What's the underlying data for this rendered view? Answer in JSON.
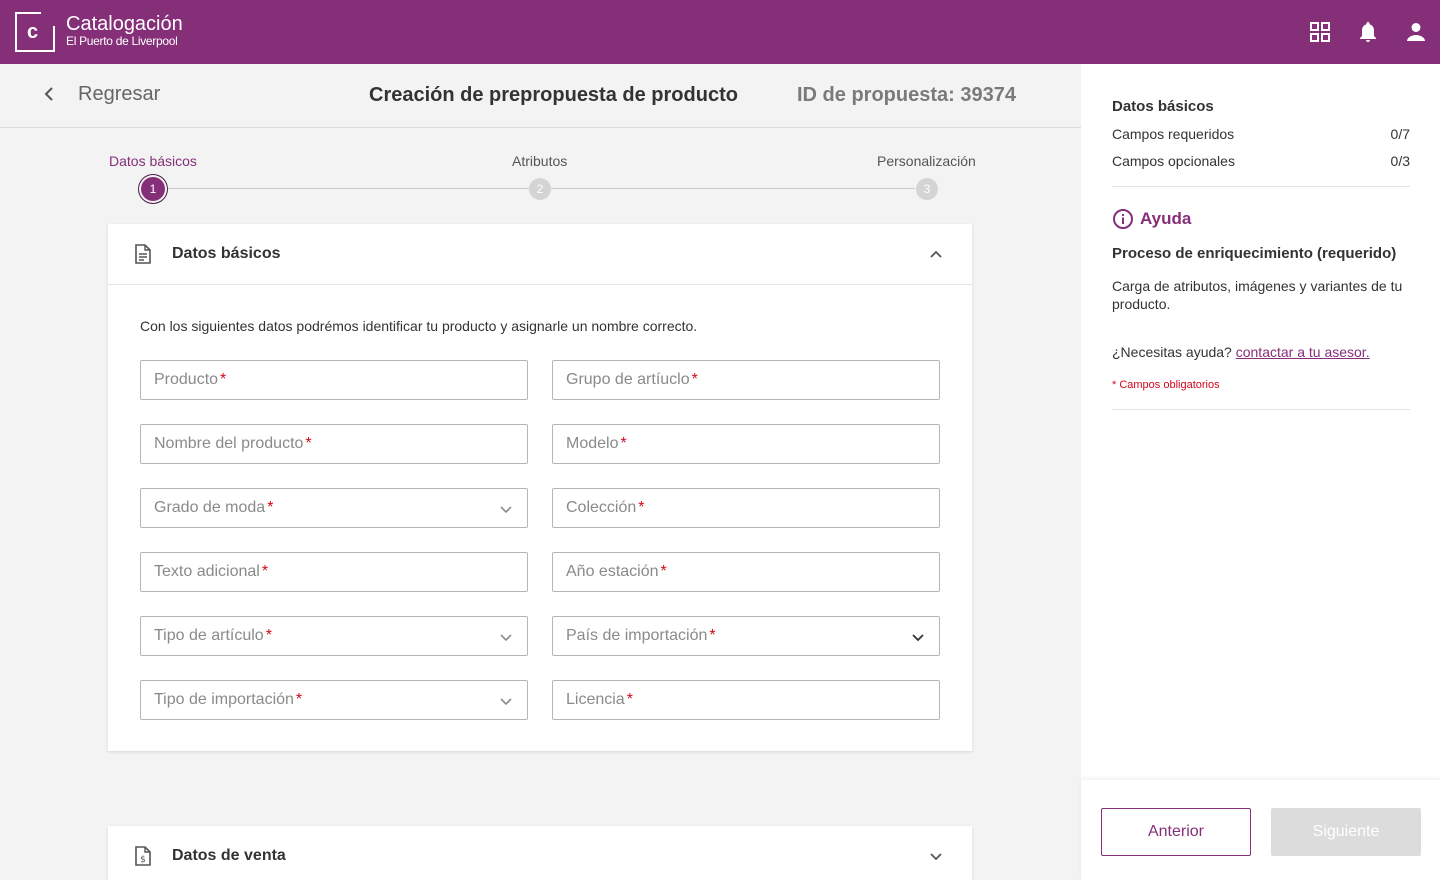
{
  "brand": {
    "name": "Catalogación",
    "sub": "El Puerto de Liverpool",
    "logo_letter": "c"
  },
  "topbar": {
    "icons": [
      "apps-grid-icon",
      "bell-icon",
      "user-icon"
    ],
    "color": "#852f79"
  },
  "header": {
    "back_label": "Regresar",
    "title": "Creación de prepropuesta de producto",
    "proposal_id": "ID de propuesta: 39374"
  },
  "stepper": {
    "steps": [
      {
        "label": "Datos básicos",
        "number": "1",
        "active": true
      },
      {
        "label": "Atributos",
        "number": "2",
        "active": false
      },
      {
        "label": "Personalización",
        "number": "3",
        "active": false
      }
    ]
  },
  "basic_card": {
    "title": "Datos básicos",
    "intro": "Con los siguientes datos podrémos identificar tu producto y asignarle un nombre correcto.",
    "required_mark": "*",
    "fields": [
      {
        "label": "Producto",
        "type": "text"
      },
      {
        "label": "Grupo de artíuclo",
        "type": "text"
      },
      {
        "label": "Nombre del producto",
        "type": "text"
      },
      {
        "label": "Modelo",
        "type": "text"
      },
      {
        "label": "Grado de moda",
        "type": "select"
      },
      {
        "label": "Colección",
        "type": "text"
      },
      {
        "label": "Texto adicional",
        "type": "text"
      },
      {
        "label": "Año estación",
        "type": "text"
      },
      {
        "label": "Tipo de artículo",
        "type": "select"
      },
      {
        "label": "País de importación",
        "type": "select"
      },
      {
        "label": "Tipo de importación",
        "type": "select"
      },
      {
        "label": "Licencia",
        "type": "text"
      }
    ]
  },
  "sales_card": {
    "title": "Datos de venta"
  },
  "panel": {
    "section_title": "Datos básicos",
    "required_label": "Campos requeridos",
    "required_count": "0/7",
    "optional_label": "Campos opcionales",
    "optional_count": "0/3",
    "help_title": "Ayuda",
    "help_subtitle": "Proceso de enriquecimiento (requerido)",
    "help_text": "Carga de atributos, imágenes y variantes de tu producto.",
    "need_help": "¿Necesitas ayuda?",
    "contact_link": "contactar a tu asesor.",
    "required_note": "* Campos obligatorios"
  },
  "footer": {
    "prev_label": "Anterior",
    "next_label": "Siguiente"
  }
}
